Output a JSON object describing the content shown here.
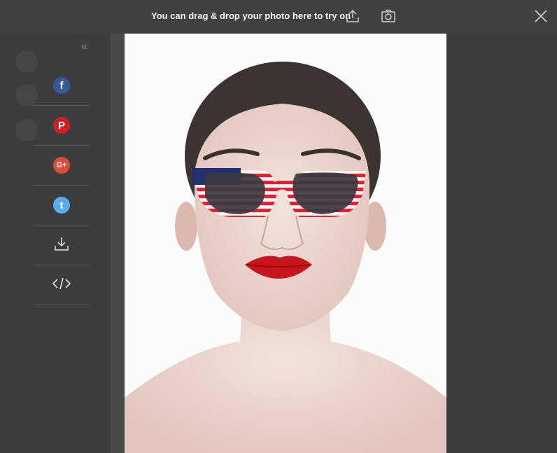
{
  "topbar": {
    "hint_text": "You can drag & drop your photo here to try on",
    "upload_icon": "upload-icon",
    "camera_icon": "camera-icon",
    "close_icon": "close-icon"
  },
  "sidebar": {
    "collapse_glyph": "«",
    "share_items": [
      {
        "name": "facebook",
        "glyph": "f",
        "color": "#3b5998"
      },
      {
        "name": "pinterest",
        "glyph": "P",
        "color": "#cb2027"
      },
      {
        "name": "google-plus",
        "glyph": "G+",
        "color": "#dd4b39"
      },
      {
        "name": "twitter",
        "glyph": "t",
        "color": "#55acee"
      },
      {
        "name": "download",
        "icon": "download-icon"
      },
      {
        "name": "embed",
        "icon": "embed-code-icon"
      }
    ]
  },
  "photo": {
    "subject": "woman-portrait",
    "overlay": "usa-flag-sunglasses"
  }
}
